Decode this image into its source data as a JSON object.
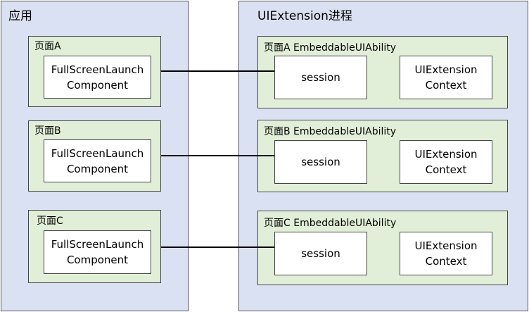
{
  "app": {
    "title": "应用",
    "pages": [
      {
        "title": "页面A",
        "component": "FullScreenLaunch\nComponent"
      },
      {
        "title": "页面B",
        "component": "FullScreenLaunch\nComponent"
      },
      {
        "title": "页面C",
        "component": "FullScreenLaunch\nComponent"
      }
    ]
  },
  "extension": {
    "title": "UIExtension进程",
    "abilities": [
      {
        "title": "页面A EmbeddableUIAbility",
        "session": "session",
        "context": "UIExtension\nContext"
      },
      {
        "title": "页面B EmbeddableUIAbility",
        "session": "session",
        "context": "UIExtension\nContext"
      },
      {
        "title": "页面C EmbeddableUIAbility",
        "session": "session",
        "context": "UIExtension\nContext"
      }
    ]
  },
  "colors": {
    "container_fill": "#dae1f2",
    "page_fill": "#e2efd8",
    "box_fill": "#ffffff",
    "connector": "#000000"
  }
}
